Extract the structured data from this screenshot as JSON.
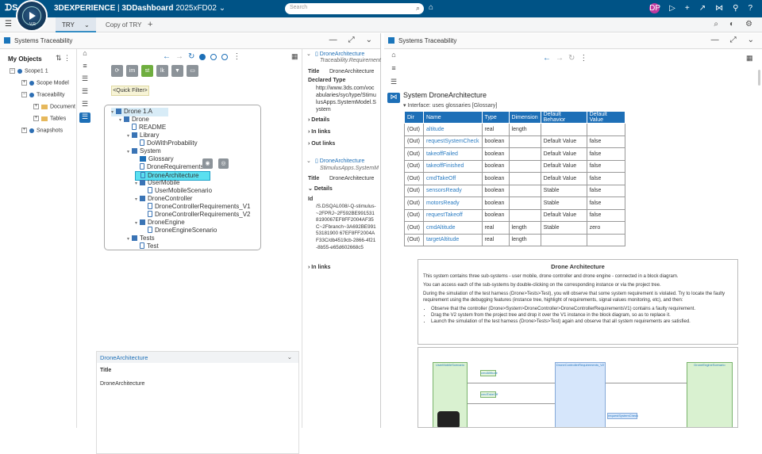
{
  "app": {
    "brand": "3DEXPERIENCE",
    "product": "3DDashboard",
    "release": "2025xFD02",
    "compass_version": "V,R",
    "search_placeholder": "Search",
    "avatar_initials": "DP"
  },
  "tabs": [
    {
      "label": "TRY",
      "active": true
    },
    {
      "label": "Copy of TRY",
      "active": false
    }
  ],
  "left_panel": {
    "title": "Systems Traceability",
    "my_objects_label": "My Objects",
    "tree": [
      {
        "label": "Scope1",
        "count": "1",
        "level": 0,
        "type": "expand"
      },
      {
        "label": "Scope Model",
        "level": 1,
        "type": "dot"
      },
      {
        "label": "Traceability",
        "level": 1,
        "type": "dot"
      },
      {
        "label": "Document",
        "level": 2,
        "type": "folder"
      },
      {
        "label": "Tables",
        "level": 2,
        "type": "folder"
      },
      {
        "label": "Snapshots",
        "level": 1,
        "type": "dot"
      }
    ],
    "quick_filter": "<Quick Filter>",
    "toolbar": [
      "im",
      "st",
      "lk"
    ],
    "struct_tree": [
      {
        "label": "Drone 1.A",
        "depth": 0,
        "icon": "sq",
        "root": true
      },
      {
        "label": "Drone",
        "depth": 1,
        "icon": "sq"
      },
      {
        "label": "README",
        "depth": 2,
        "icon": "req"
      },
      {
        "label": "Library",
        "depth": 2,
        "icon": "sq"
      },
      {
        "label": "DoWithProbability",
        "depth": 3,
        "icon": "req"
      },
      {
        "label": "System",
        "depth": 2,
        "icon": "sq"
      },
      {
        "label": "Glossary",
        "depth": 3,
        "icon": "gl"
      },
      {
        "label": "DroneRequirements",
        "depth": 3,
        "icon": "req"
      },
      {
        "label": "DroneArchitecture",
        "depth": 3,
        "icon": "req",
        "selected": true
      },
      {
        "label": "UserMobile",
        "depth": 3,
        "icon": "sq"
      },
      {
        "label": "UserMobileScenario",
        "depth": 4,
        "icon": "req"
      },
      {
        "label": "DroneController",
        "depth": 3,
        "icon": "sq"
      },
      {
        "label": "DroneControllerRequirements_V1",
        "depth": 4,
        "icon": "req"
      },
      {
        "label": "DroneControllerRequirements_V2",
        "depth": 4,
        "icon": "req"
      },
      {
        "label": "DroneEngine",
        "depth": 3,
        "icon": "sq"
      },
      {
        "label": "DroneEngineScenario",
        "depth": 4,
        "icon": "req"
      },
      {
        "label": "Tests",
        "depth": 2,
        "icon": "sq"
      },
      {
        "label": "Test",
        "depth": 3,
        "icon": "req"
      }
    ],
    "detail": {
      "header": "DroneArchitecture",
      "title_label": "Title",
      "title_value": "DroneArchitecture"
    }
  },
  "properties": {
    "card1": {
      "name": "DroneArchitecture",
      "kind": "Traceability.Requirement",
      "title_label": "Title",
      "title_value": "DroneArchitecture",
      "declared_type_label": "Declared Type",
      "declared_type_value": "http://www.3ds.com/vocabularies/syc/type/StimulusApps.SystemModel.System",
      "details": "Details",
      "in_links": "In links",
      "out_links": "Out links"
    },
    "card2": {
      "name": "DroneArchitecture",
      "kind": "StimulusApps.SystemM",
      "title_label": "Title",
      "title_value": "DroneArchitecture",
      "details": "Details",
      "id_label": "Id",
      "id_value": "/S.DSQAL008/-Q-stimulus-~2FPRJ~2F592BE9915318190067EF8FF2004AF35C~2Fbranch~3A692BE99153181900 67EF8FF2004AF33C/db4519cb-2866-4f21-8b55-e65d602668c5",
      "in_links": "In links"
    }
  },
  "right_panel": {
    "title": "Systems Traceability",
    "system_name": "System DroneArchitecture",
    "interface_line": "Interface: uses glossaries [Glossary]",
    "columns": [
      "Dir",
      "Name",
      "Type",
      "Dimension",
      "Default Behavior",
      "Default Value"
    ],
    "rows": [
      [
        "(Out)",
        "altitude",
        "real",
        "length",
        "",
        ""
      ],
      [
        "(Out)",
        "requestSystemCheck",
        "boolean",
        "",
        "Default Value",
        "false"
      ],
      [
        "(Out)",
        "takeoffFailed",
        "boolean",
        "",
        "Default Value",
        "false"
      ],
      [
        "(Out)",
        "takeoffFinished",
        "boolean",
        "",
        "Default Value",
        "false"
      ],
      [
        "(Out)",
        "cmdTakeOff",
        "boolean",
        "",
        "Default Value",
        "false"
      ],
      [
        "(Out)",
        "sensorsReady",
        "boolean",
        "",
        "Stable",
        "false"
      ],
      [
        "(Out)",
        "motorsReady",
        "boolean",
        "",
        "Stable",
        "false"
      ],
      [
        "(Out)",
        "requestTakeoff",
        "boolean",
        "",
        "Default Value",
        "false"
      ],
      [
        "(Out)",
        "cmdAltitude",
        "real",
        "length",
        "Stable",
        "zero"
      ],
      [
        "(Out)",
        "targetAltitude",
        "real",
        "length",
        "",
        ""
      ]
    ],
    "doc": {
      "heading": "Drone Architecture",
      "p1": "This system contains three sub-systems - user mobile, drone controller and drone engine - connected in a block diagram.",
      "p2": "You can access each of the sub-systems by double-clicking on the corresponding instance or via the project tree.",
      "p3": "During the simulation of the test harness (Drone>Tests>Test), you will observe that some system requirement is violated. Try to locate the faulty requirement using the debugging features (instance tree, highlight of requirements, signal values monitoring, etc), and then:",
      "b1": "Observe that the controller (Drone>System>DroneController>DroneControllerRequirementsV1) contains a faulty requirement.",
      "b2": "Drag the V2 system from the project tree and drop it over the V1 instance in the block diagram, so as to replace it.",
      "b3": "Launch the simulation of the test harness (Drone>Tests>Test) again and observe that all system requirements are satisfied."
    },
    "diagram": {
      "blocks": [
        "UserMobileScenario",
        "DroneControllerRequirements_V2",
        "DroneEngineScenario"
      ],
      "ports": [
        "cmdAltitude",
        "cmdTakeOff",
        "requestSystemCheck"
      ]
    }
  }
}
